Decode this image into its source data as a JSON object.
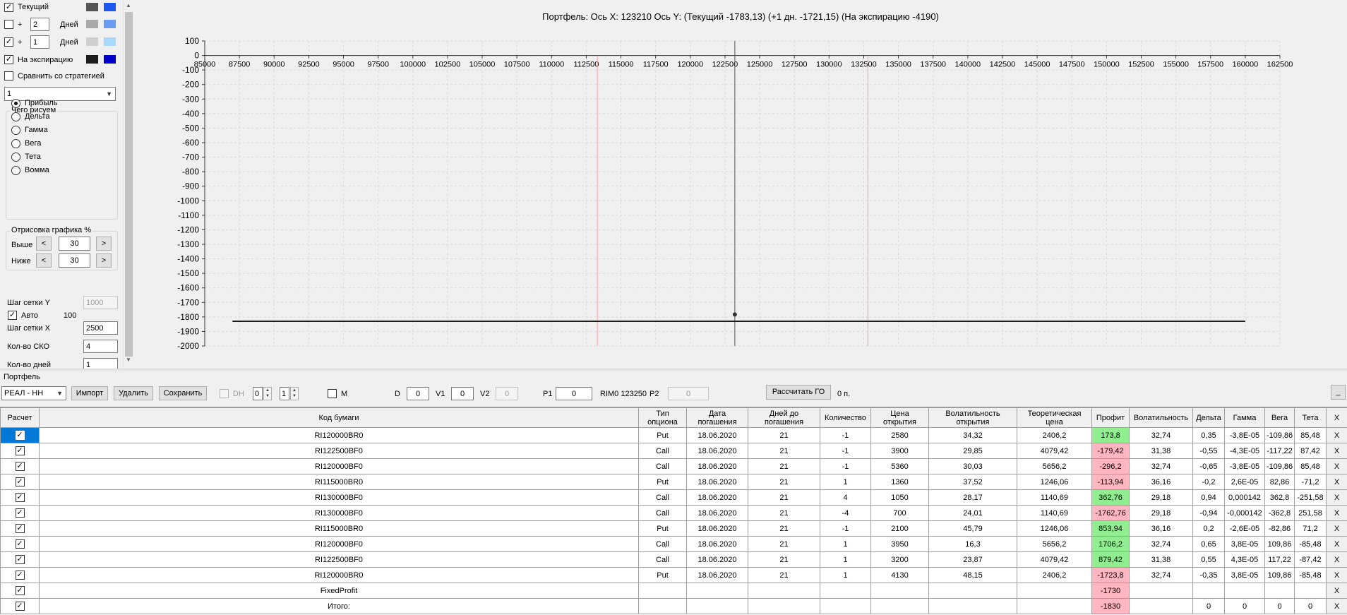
{
  "left_panel": {
    "current": {
      "label": "Текущий",
      "checked": "✓"
    },
    "plus_days_1": {
      "plus": "+",
      "value": "2",
      "unit": "Дней",
      "checked": ""
    },
    "plus_days_2": {
      "plus": "+",
      "value": "1",
      "unit": "Дней",
      "checked": "✓"
    },
    "expiration": {
      "label": "На экспирацию",
      "checked": "✓"
    },
    "compare": {
      "label": "Сравнить со стратегией",
      "checked": ""
    },
    "strategy_select": "1",
    "draw_group": {
      "title": "Чего рисуем",
      "options": [
        "Прибыль",
        "Дельта",
        "Гамма",
        "Вега",
        "Тета",
        "Вомма"
      ],
      "selected": "Прибыль"
    },
    "render_group": {
      "title": "Отрисовка графика %",
      "above_label": "Выше",
      "above_value": "30",
      "below_label": "Ниже",
      "below_value": "30",
      "dec": "<",
      "inc": ">"
    },
    "grid_step_y": {
      "label": "Шаг сетки Y",
      "value": "1000"
    },
    "auto": {
      "label": "Авто",
      "value": "100",
      "checked": "✓"
    },
    "grid_step_x": {
      "label": "Шаг сетки X",
      "value": "2500"
    },
    "sko_count": {
      "label": "Кол-во СКО",
      "value": "4"
    },
    "days_count": {
      "label": "Кол-во дней",
      "value": "1"
    }
  },
  "colors": {
    "current_a": "#545454",
    "current_b": "#1e56f0",
    "plus1_a": "#a9a9a9",
    "plus1_b": "#6a9df2",
    "plus2_a": "#cfcfcf",
    "plus2_b": "#a9d9fa",
    "exp_a": "#1c1c1c",
    "exp_b": "#0000c8",
    "profit_pos": "#90ee90",
    "profit_neg": "#ffb6c1",
    "selected_row": "#0078d7",
    "sigma_line": "#f4a0a8"
  },
  "chart_data": {
    "type": "line",
    "title": "Портфель: Ось X: 123210 Ось Y:  (Текущий -1783,13)  (+1 дн. -1721,15)  (На экспирацию -4190)",
    "xlabel": "",
    "ylabel": "",
    "xlim": [
      85000,
      162500
    ],
    "ylim": [
      -2000,
      100
    ],
    "x_ticks": [
      "85000",
      "87500",
      "90000",
      "92500",
      "95000",
      "97500",
      "100000",
      "102500",
      "105000",
      "107500",
      "110000",
      "112500",
      "115000",
      "117500",
      "120000",
      "122500",
      "125000",
      "127500",
      "130000",
      "132500",
      "135000",
      "137500",
      "140000",
      "142500",
      "145000",
      "147500",
      "150000",
      "152500",
      "155000",
      "157500",
      "160000",
      "162500"
    ],
    "y_ticks": [
      "100",
      "0",
      "-100",
      "-200",
      "-300",
      "-400",
      "-500",
      "-600",
      "-700",
      "-800",
      "-900",
      "-1000",
      "-1100",
      "-1200",
      "-1300",
      "-1400",
      "-1500",
      "-1600",
      "-1700",
      "-1800",
      "-1900",
      "-2000"
    ],
    "grid": true,
    "series": [
      {
        "x": [
          87000,
          160000
        ],
        "y": [
          -1830,
          -1830
        ]
      }
    ],
    "current_x": 123210,
    "current_point": {
      "x": 123210,
      "y": -1783
    },
    "sigma_lines": [
      113300,
      132800
    ]
  },
  "portfolio": {
    "label": "Портфель",
    "account": "РЕАЛ - НН",
    "import": "Импорт",
    "delete": "Удалить",
    "save": "Сохранить",
    "dh_label": "DH",
    "dh_checked": "",
    "spin1": "0",
    "spin2": "1",
    "m_label": "M",
    "m_checked": "",
    "d_label": "D",
    "d_value": "0",
    "v1_label": "V1",
    "v1_value": "0",
    "v2_label": "V2",
    "v2_value": "0",
    "p1_label": "P1",
    "p1_value": "0",
    "rim": "RIM0 123250",
    "p2_label": "P2",
    "p2_value": "0",
    "calc_go": "Рассчитать ГО",
    "go_value": "0 п.",
    "minimize": "_"
  },
  "table": {
    "headers": {
      "calc": "Расчет",
      "code": "Код бумаги",
      "type_1": "Тип",
      "type_2": "опциона",
      "date_1": "Дата",
      "date_2": "погашения",
      "days_1": "Дней до",
      "days_2": "погашения",
      "qty": "Количество",
      "price_1": "Цена",
      "price_2": "открытия",
      "vol_1": "Волатильность",
      "vol_2": "открытия",
      "theo_1": "Теоретическая",
      "theo_2": "цена",
      "profit": "Профит",
      "volatility": "Волатильность",
      "delta": "Дельта",
      "gamma": "Гамма",
      "vega": "Вега",
      "theta": "Тета",
      "x": "X"
    },
    "rows": [
      {
        "code": "RI120000BR0",
        "type": "Put",
        "date": "18.06.2020",
        "days": "21",
        "qty": "-1",
        "price": "2580",
        "vol": "34,32",
        "theo": "2406,2",
        "profit": "173,8",
        "volatility": "32,74",
        "delta": "0,35",
        "gamma": "-3,8E-05",
        "vega": "-109,86",
        "theta": "85,48",
        "x": "X",
        "check": "✓"
      },
      {
        "code": "RI122500BF0",
        "type": "Call",
        "date": "18.06.2020",
        "days": "21",
        "qty": "-1",
        "price": "3900",
        "vol": "29,85",
        "theo": "4079,42",
        "profit": "-179,42",
        "volatility": "31,38",
        "delta": "-0,55",
        "gamma": "-4,3E-05",
        "vega": "-117,22",
        "theta": "87,42",
        "x": "X",
        "check": "✓"
      },
      {
        "code": "RI120000BF0",
        "type": "Call",
        "date": "18.06.2020",
        "days": "21",
        "qty": "-1",
        "price": "5360",
        "vol": "30,03",
        "theo": "5656,2",
        "profit": "-296,2",
        "volatility": "32,74",
        "delta": "-0,65",
        "gamma": "-3,8E-05",
        "vega": "-109,86",
        "theta": "85,48",
        "x": "X",
        "check": "✓"
      },
      {
        "code": "RI115000BR0",
        "type": "Put",
        "date": "18.06.2020",
        "days": "21",
        "qty": "1",
        "price": "1360",
        "vol": "37,52",
        "theo": "1246,06",
        "profit": "-113,94",
        "volatility": "36,16",
        "delta": "-0,2",
        "gamma": "2,6E-05",
        "vega": "82,86",
        "theta": "-71,2",
        "x": "X",
        "check": "✓"
      },
      {
        "code": "RI130000BF0",
        "type": "Call",
        "date": "18.06.2020",
        "days": "21",
        "qty": "4",
        "price": "1050",
        "vol": "28,17",
        "theo": "1140,69",
        "profit": "362,76",
        "volatility": "29,18",
        "delta": "0,94",
        "gamma": "0,000142",
        "vega": "362,8",
        "theta": "-251,58",
        "x": "X",
        "check": "✓"
      },
      {
        "code": "RI130000BF0",
        "type": "Call",
        "date": "18.06.2020",
        "days": "21",
        "qty": "-4",
        "price": "700",
        "vol": "24,01",
        "theo": "1140,69",
        "profit": "-1762,76",
        "volatility": "29,18",
        "delta": "-0,94",
        "gamma": "-0,000142",
        "vega": "-362,8",
        "theta": "251,58",
        "x": "X",
        "check": "✓"
      },
      {
        "code": "RI115000BR0",
        "type": "Put",
        "date": "18.06.2020",
        "days": "21",
        "qty": "-1",
        "price": "2100",
        "vol": "45,79",
        "theo": "1246,06",
        "profit": "853,94",
        "volatility": "36,16",
        "delta": "0,2",
        "gamma": "-2,6E-05",
        "vega": "-82,86",
        "theta": "71,2",
        "x": "X",
        "check": "✓"
      },
      {
        "code": "RI120000BF0",
        "type": "Call",
        "date": "18.06.2020",
        "days": "21",
        "qty": "1",
        "price": "3950",
        "vol": "16,3",
        "theo": "5656,2",
        "profit": "1706,2",
        "volatility": "32,74",
        "delta": "0,65",
        "gamma": "3,8E-05",
        "vega": "109,86",
        "theta": "-85,48",
        "x": "X",
        "check": "✓"
      },
      {
        "code": "RI122500BF0",
        "type": "Call",
        "date": "18.06.2020",
        "days": "21",
        "qty": "1",
        "price": "3200",
        "vol": "23,87",
        "theo": "4079,42",
        "profit": "879,42",
        "volatility": "31,38",
        "delta": "0,55",
        "gamma": "4,3E-05",
        "vega": "117,22",
        "theta": "-87,42",
        "x": "X",
        "check": "✓"
      },
      {
        "code": "RI120000BR0",
        "type": "Put",
        "date": "18.06.2020",
        "days": "21",
        "qty": "1",
        "price": "4130",
        "vol": "48,15",
        "theo": "2406,2",
        "profit": "-1723,8",
        "volatility": "32,74",
        "delta": "-0,35",
        "gamma": "3,8E-05",
        "vega": "109,86",
        "theta": "-85,48",
        "x": "X",
        "check": "✓"
      },
      {
        "code": "FixedProfit",
        "type": "",
        "date": "",
        "days": "",
        "qty": "",
        "price": "",
        "vol": "",
        "theo": "",
        "profit": "-1730",
        "volatility": "",
        "delta": "",
        "gamma": "",
        "vega": "",
        "theta": "",
        "x": "X",
        "check": "✓"
      },
      {
        "code": "Итого:",
        "type": "",
        "date": "",
        "days": "",
        "qty": "",
        "price": "",
        "vol": "",
        "theo": "",
        "profit": "-1830",
        "volatility": "",
        "delta": "0",
        "gamma": "0",
        "vega": "0",
        "theta": "0",
        "x": "X",
        "check": "✓"
      }
    ]
  }
}
